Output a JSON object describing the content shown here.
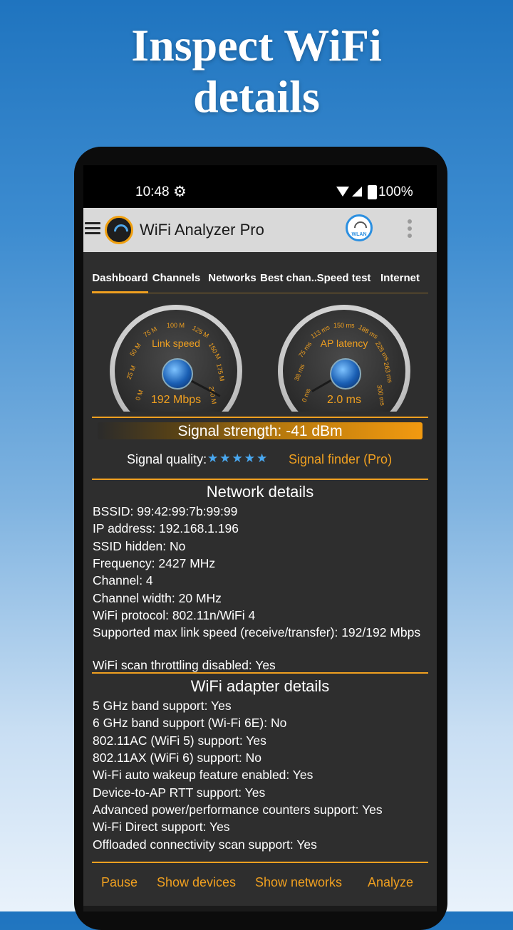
{
  "promo": {
    "line1": "Inspect WiFi",
    "line2": "details"
  },
  "status": {
    "time": "10:48",
    "battery": "100%"
  },
  "app": {
    "title": "WiFi Analyzer Pro",
    "wlan_label": "WLAN"
  },
  "tabs": [
    "Dashboard",
    "Channels",
    "Networks",
    "Best chan..",
    "Speed test",
    "Internet"
  ],
  "gauges": {
    "link": {
      "label": "Link speed",
      "value": "192 Mbps",
      "ticks": [
        "0 M",
        "25 M",
        "50 M",
        "75 M",
        "100 M",
        "125 M",
        "150 M",
        "175 M",
        "200 M"
      ]
    },
    "latency": {
      "label": "AP latency",
      "value": "2.0 ms",
      "ticks": [
        "0 ms",
        "38 ms",
        "75 ms",
        "113 ms",
        "150 ms",
        "188 ms",
        "225 ms",
        "263 ms",
        "300 ms"
      ]
    }
  },
  "signal": {
    "strength": "Signal strength: -41 dBm",
    "quality_label": "Signal quality:",
    "stars": "★★★★★",
    "finder": "Signal finder (Pro)"
  },
  "network": {
    "title": "Network details",
    "lines": [
      "BSSID: 99:42:99:7b:99:99",
      "IP address: 192.168.1.196",
      "SSID hidden: No",
      "Frequency: 2427 MHz",
      "Channel: 4",
      "Channel width: 20 MHz",
      "WiFi protocol: 802.11n/WiFi 4",
      "Supported max link speed (receive/transfer): 192/192 Mbps",
      "WiFi scan throttling disabled: Yes"
    ]
  },
  "adapter": {
    "title": "WiFi adapter details",
    "lines": [
      "5 GHz band support: Yes",
      "6 GHz band support (Wi-Fi 6E): No",
      "802.11AC (WiFi 5) support: Yes",
      "802.11AX (WiFi 6) support: No",
      "Wi-Fi auto wakeup feature enabled: Yes",
      "Device-to-AP RTT support: Yes",
      "Advanced power/performance counters support: Yes",
      "Wi-Fi Direct support: Yes",
      "Offloaded connectivity scan support: Yes"
    ]
  },
  "bottom": {
    "pause": "Pause",
    "devices": "Show devices",
    "networks": "Show networks",
    "analyze": "Analyze"
  },
  "colors": {
    "accent": "#f0a020",
    "star": "#49a8f0",
    "background": "#2e2e2e"
  }
}
